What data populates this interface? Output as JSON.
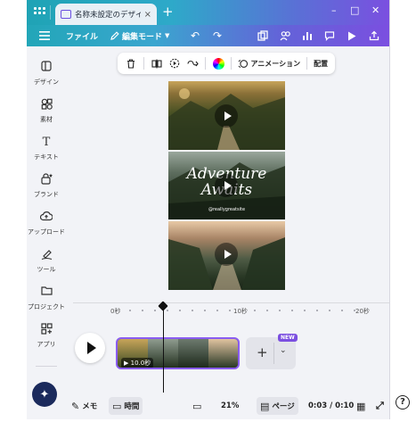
{
  "tabbar": {
    "tab_title": "名称未設定のデザイ...",
    "tab_close": "×",
    "add_tab": "+",
    "minimize": "–",
    "maximize": "□",
    "close": "✕"
  },
  "toolbar": {
    "file_label": "ファイル",
    "edit_mode_label": "編集モード"
  },
  "sidebar": {
    "items": [
      {
        "label": "デザイン",
        "icon": "layout-icon"
      },
      {
        "label": "素材",
        "icon": "shapes-icon"
      },
      {
        "label": "テキスト",
        "icon": "text-icon"
      },
      {
        "label": "ブランド",
        "icon": "brand-icon"
      },
      {
        "label": "アップロード",
        "icon": "upload-icon"
      },
      {
        "label": "ツール",
        "icon": "draw-icon"
      },
      {
        "label": "プロジェクト",
        "icon": "folder-icon"
      },
      {
        "label": "アプリ",
        "icon": "apps-icon"
      }
    ]
  },
  "context_toolbar": {
    "animation_label": "アニメーション",
    "position_label": "配置"
  },
  "canvas": {
    "page2_title": "Adventure Awaits",
    "page2_handle": "@reallygreatsite"
  },
  "timeline": {
    "ticks": [
      "0秒",
      "10秒",
      "20秒"
    ],
    "clip_duration": "10.0秒",
    "new_badge": "NEW"
  },
  "footer": {
    "notes_label": "メモ",
    "time_label": "時間",
    "zoom": "21%",
    "pages_label": "ページ",
    "time_readout": "0:03 / 0:10"
  },
  "colors": {
    "accent": "#7b4fe0",
    "toolbar_start": "#22a6b8",
    "toolbar_end": "#7b4fe0"
  }
}
